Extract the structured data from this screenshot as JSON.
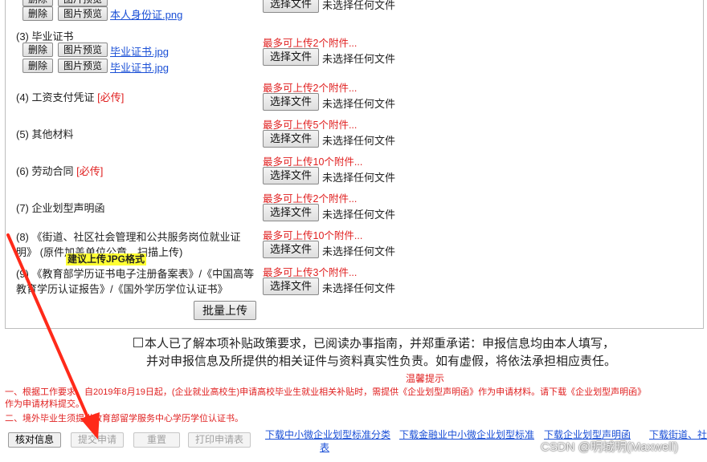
{
  "common": {
    "delete_label": "删除",
    "preview_label": "图片预览",
    "choose_file_label": "选择文件",
    "no_file_label": "未选择任何文件"
  },
  "sections": {
    "s2": {
      "file2": "本人身份证.png"
    },
    "s3": {
      "label": "(3) 毕业证书",
      "limit": "最多可上传2个附件...",
      "file1": "毕业证书.jpg",
      "file2": "毕业证书.jpg"
    },
    "s4": {
      "label": "(4) 工资支付凭证 ",
      "required": "[必传]",
      "limit": "最多可上传2个附件..."
    },
    "s5": {
      "label": "(5) 其他材料",
      "limit": "最多可上传5个附件..."
    },
    "s6": {
      "label": "(6) 劳动合同 ",
      "required": "[必传]",
      "limit": "最多可上传10个附件..."
    },
    "s7": {
      "label": "(7) 企业划型声明函",
      "limit": "最多可上传2个附件..."
    },
    "s8": {
      "line1": "(8) 《街道、社区社会管理和公共服务岗位就业证",
      "line2": "明》 (原件加盖单位公章，扫描上传)",
      "limit": "最多可上传10个附件..."
    },
    "s9": {
      "line1": "(9) 《教育部学历证书电子注册备案表》/《中国高等",
      "line2": "教育学历认证报告》/《国外学历学位认证书》",
      "limit": "最多可上传3个附件..."
    }
  },
  "batch_upload_label": "批量上传",
  "tooltip_text": "建议上传JPG格式",
  "declaration": {
    "line1": "本人已了解本项补贴政策要求，已阅读办事指南，并郑重承诺：申报信息均由本人填写，",
    "line2": "并对申报信息及所提供的相关证件与资料真实性负责。如有虚假，将依法承担相应责任。"
  },
  "tips": {
    "title": "温馨提示",
    "tip1_line1": "一、根据工作要求，自2019年8月19日起，(企业就业高校生)申请高校毕业生就业相关补贴时，需提供《企业划型声明函》作为申请材料。请下载《企业划型声明函》",
    "tip1_line2": "作为申请材料提交。",
    "tip2": "二、境外毕业生须提供教育部留学服务中心学历学位认证书。"
  },
  "footer": {
    "verify_label": "核对信息",
    "submit_label": "提交申请",
    "reset_label": "重置",
    "print_label": "打印申请表",
    "downloads": [
      "下载中小微企业划型标准分类",
      "表",
      "下载金融业中小微企业划型标准",
      "下载企业划型声明函",
      "下载街道、社"
    ]
  },
  "watermark": "CSDN @明城明(Maxwell)",
  "colors": {
    "required_red": "#e02020",
    "link_blue": "#1a4fd6",
    "tooltip_yellow": "#ffff33",
    "arrow_red": "#ff2a1a"
  }
}
